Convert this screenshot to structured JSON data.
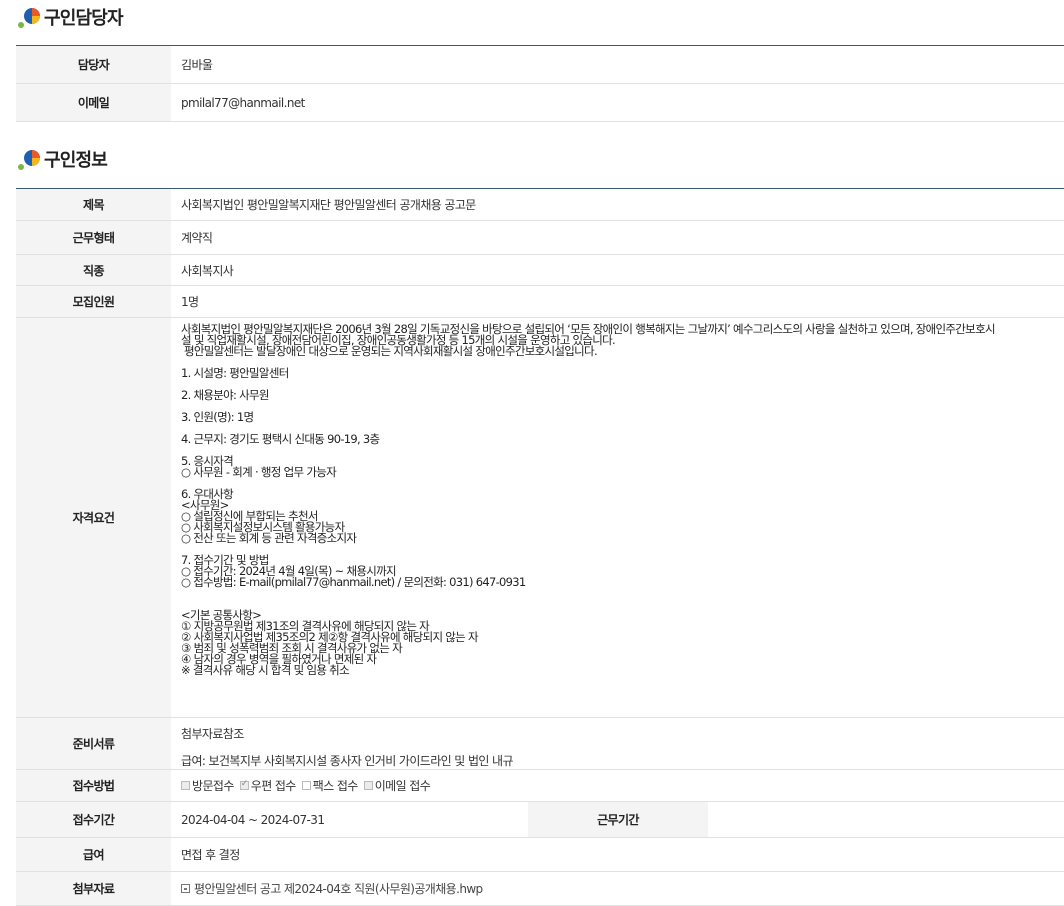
{
  "contact_section": {
    "title": "구인담당자",
    "rows": [
      {
        "label": "담당자",
        "value": "김바울"
      },
      {
        "label": "이메일",
        "value": "pmilal77@hanmail.net"
      }
    ]
  },
  "job_section": {
    "title": "구인정보",
    "title_row": {
      "label": "제목",
      "value": "사회복지법인 평안밀알복지재단 평안밀알센터 공개채용 공고문"
    },
    "work_type": {
      "label": "근무형태",
      "value": "계약직"
    },
    "occupation": {
      "label": "직종",
      "value": "사회복지사"
    },
    "headcount": {
      "label": "모집인원",
      "value": "1명"
    },
    "qualifications": {
      "label": "자격요건",
      "text": "사회복지법인 평안밀알복지재단은 2006년 3월 28일 기독교정신을 바탕으로 설립되어 ‘모든 장애인이 행복해지는 그날까지’ 예수그리스도의 사랑을 실천하고 있으며, 장애인주간보호시\n설 및 직업재활시설, 장애전담어린이집, 장애인공동생활가정 등 15개의 시설을 운영하고 있습니다.\n 평안밀알센터는 발달장애인 대상으로 운영되는 지역사회재활시설 장애인주간보호시설입니다.\n\n1. 시설명: 평안밀알센터\n\n2. 채용분야: 사무원\n\n3. 인원(명): 1명\n\n4. 근무지: 경기도 평택시 신대동 90-19, 3층\n\n5. 응시자격\n○ 사무원 - 회계 · 행정 업무 가능자\n\n6. 우대사항\n<사무원>\n○ 설립정신에 부합되는 추천서\n○ 사회복지설정보시스템 활용가능자\n○ 전산 또는 회계 등 관련 자격증소지자\n\n7. 접수기간 및 방법\n○ 접수기간: 2024년 4월 4일(목) ~ 채용시까지\n○ 접수방법: E-mail(pmilal77@hanmail.net) / 문의전화: 031) 647-0931\n\n\n<기본 공통사항>\n① 지방공무원법 제31조의 결격사유에 해당되지 않는 자\n② 사회복지사업법 제35조의2 제②항 결격사유에 해당되지 않는 자\n③ 범죄 및 성폭력범죄 조회 시 결격사유가 없는 자\n④ 남자의 경우 병역을 필하였거나 면제된 자\n※ 결격사유 해당 시 합격 및 임용 취소"
    },
    "documents": {
      "label": "준비서류",
      "line1": "첨부자료참조",
      "line2": "급여: 보건복지부 사회복지시설 종사자 인거비 가이드라인 및 법인 내규"
    },
    "apply_method": {
      "label": "접수방법",
      "options": [
        {
          "text": "방문접수",
          "checked": false
        },
        {
          "text": "우편 접수",
          "checked": true
        },
        {
          "text": "팩스 접수",
          "checked": false
        },
        {
          "text": "이메일 접수",
          "checked": false
        }
      ]
    },
    "apply_period": {
      "label": "접수기간",
      "value": "2024-04-04 ~ 2024-07-31",
      "label2": "근무기간",
      "value2": ""
    },
    "salary": {
      "label": "급여",
      "value": "면접 후 결정"
    },
    "attachment": {
      "label": "첨부자료",
      "value": "평안밀알센터 공고 제2024-04호 직원(사무원)공개채용.hwp"
    }
  }
}
